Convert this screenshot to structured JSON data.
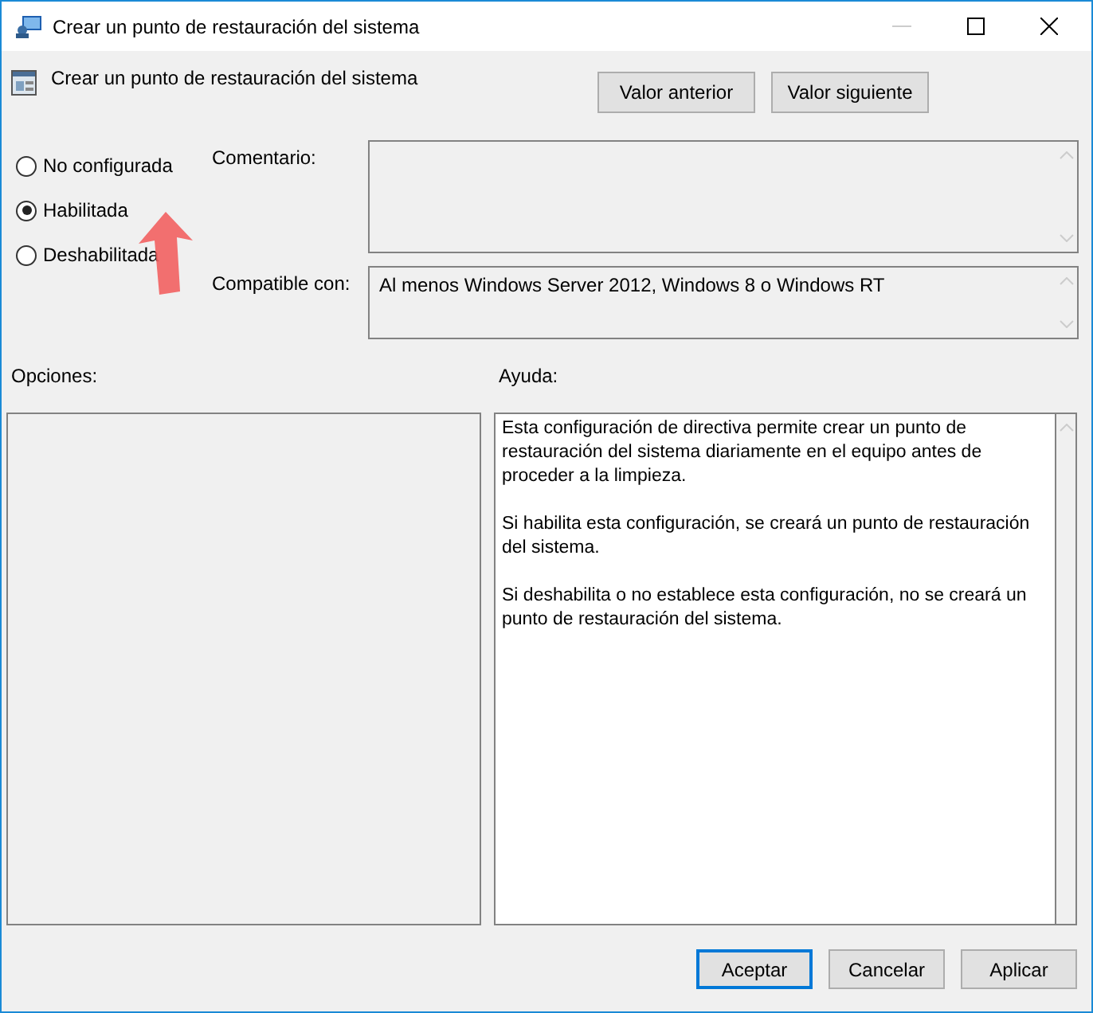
{
  "window": {
    "title": "Crear un punto de restauración del sistema"
  },
  "header": {
    "title": "Crear un punto de restauración del sistema"
  },
  "nav_buttons": [
    "Valor anterior",
    "Valor siguiente"
  ],
  "radios": [
    {
      "label": "No configurada",
      "selected": false
    },
    {
      "label": "Habilitada",
      "selected": true
    },
    {
      "label": "Deshabilitada",
      "selected": false
    }
  ],
  "comment": {
    "label": "Comentario:"
  },
  "compatible": {
    "label": "Compatible con:",
    "value": "Al menos Windows Server 2012, Windows 8 o Windows RT"
  },
  "options": {
    "label": "Opciones:"
  },
  "help": {
    "label": "Ayuda:",
    "paragraphs": [
      "Esta configuración de directiva permite crear un punto de restauración del sistema diariamente en el equipo antes de proceder a la limpieza.",
      "Si habilita esta configuración, se creará un punto de restauración del sistema.",
      "Si deshabilita o no establece esta configuración, no se creará un punto de restauración del sistema."
    ]
  },
  "buttons": [
    {
      "label": "Aceptar",
      "default": true
    },
    {
      "label": "Cancelar",
      "default": false
    },
    {
      "label": "Aplicar",
      "default": false
    }
  ]
}
